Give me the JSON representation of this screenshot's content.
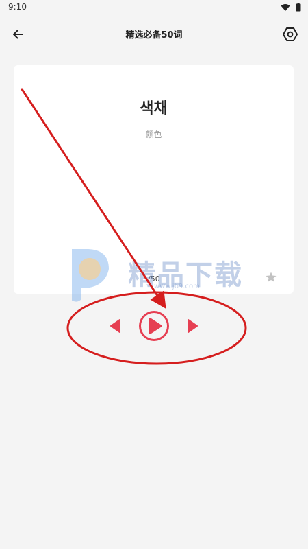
{
  "status_bar": {
    "time": "9:10",
    "icons": [
      "wifi-icon",
      "battery-icon"
    ]
  },
  "app_bar": {
    "title": "精选必备50词",
    "back_icon": "arrow-left-icon",
    "settings_icon": "gear-icon"
  },
  "card": {
    "word": "색채",
    "meaning": "颜色",
    "counter": "/50",
    "favorite_icon": "star-icon"
  },
  "controls": {
    "prev_icon": "triangle-left-icon",
    "play_icon": "play-circle-icon",
    "next_icon": "triangle-right-icon"
  },
  "watermark": {
    "text": "精品下载",
    "url": "www.jb9.com"
  },
  "colors": {
    "accent": "#e63f52",
    "annotation": "#d51e1e",
    "background": "#f4f4f4",
    "card": "#ffffff"
  }
}
